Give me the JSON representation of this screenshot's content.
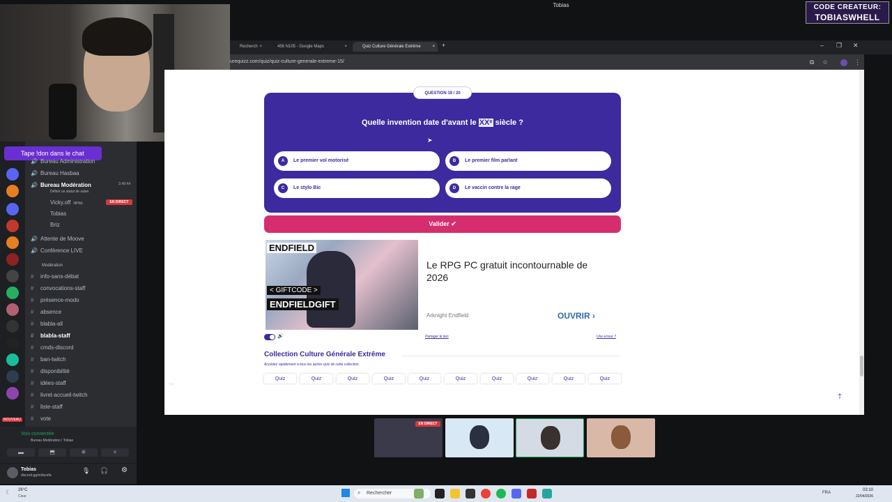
{
  "top_label": "Tobias",
  "creator": {
    "line1": "CODE CREATEUR:",
    "line2": "TOBIASWHELL"
  },
  "chat_prompt": "Tape !don dans le chat",
  "discord": {
    "channels": [
      {
        "label": "Bureau Administration",
        "icon": "🔊"
      },
      {
        "label": "Bureau Hasbaa",
        "icon": "🔊"
      },
      {
        "label": "Bureau Modération",
        "icon": "🔊",
        "active": true,
        "time": "3:49:44"
      },
      {
        "label": "Définir un statut de salon",
        "icon": ""
      },
      {
        "label": "Vicky.off",
        "icon": "",
        "tag": "NFWL"
      },
      {
        "label": "Tobias",
        "icon": ""
      },
      {
        "label": "Briz",
        "icon": ""
      },
      {
        "label": "Attente de Moove",
        "icon": "🔊"
      },
      {
        "label": "Conférence LIVE",
        "icon": "🔊"
      },
      {
        "label": "Modération",
        "icon": ""
      },
      {
        "label": "info-sans-débat",
        "icon": "#"
      },
      {
        "label": "convocations-staff",
        "icon": "#"
      },
      {
        "label": "présence-modo",
        "icon": "#"
      },
      {
        "label": "absence",
        "icon": "#"
      },
      {
        "label": "blabla-all",
        "icon": "#"
      },
      {
        "label": "blabla-staff",
        "icon": "#",
        "active": true
      },
      {
        "label": "cmds-discord",
        "icon": "#"
      },
      {
        "label": "ban-twitch",
        "icon": "#"
      },
      {
        "label": "disponibilité",
        "icon": "#"
      },
      {
        "label": "idées-staff",
        "icon": "#"
      },
      {
        "label": "livret-accueil-twitch",
        "icon": "#"
      },
      {
        "label": "liste-staff",
        "icon": "#"
      },
      {
        "label": "vote",
        "icon": "#"
      }
    ],
    "live_badge": "EN DIRECT",
    "voice_connected": "Voix connectée",
    "voice_channel": "Bureau Modération / Tobias",
    "user_name": "Tobias",
    "user_status": "discord.gg/nofacefa",
    "new_badge": "NOUVEAU"
  },
  "browser": {
    "tabs": [
      {
        "label": "Recherch",
        "close": "×"
      },
      {
        "label": "456 N105 - Google Maps",
        "close": "×"
      },
      {
        "label": "Quiz Culture Générale Extrême",
        "close": "×",
        "active": true
      }
    ],
    "new_tab": "+",
    "url": "urequizz.com/quiz/quiz-culture-generale-extreme-15/",
    "window_controls": [
      "–",
      "❐",
      "✕"
    ]
  },
  "quiz": {
    "badge": "QUESTION 19 / 20",
    "question_before": "Quelle invention date d'avant le ",
    "question_highlight": "XXᵉ",
    "question_after": " siècle ?",
    "answers": [
      {
        "letter": "A",
        "text": "Le premier vol motorisé"
      },
      {
        "letter": "B",
        "text": "Le premier film parlant"
      },
      {
        "letter": "C",
        "text": "Le stylo Bic"
      },
      {
        "letter": "D",
        "text": "Le vaccin contre la rage"
      }
    ],
    "validate_label": "Valider  ✔"
  },
  "ad": {
    "logo": "ENDFIELD",
    "giftcode_label": "< GIFTCODE >",
    "giftcode": "ENDFIELDGIFT",
    "title": "Le RPG PC gratuit incontournable de 2026",
    "source": "Arknight Endfield",
    "cta": "OUVRIR",
    "cta_arrow": "›"
  },
  "share_link": "Partager le lien",
  "error_link": "Une erreur ?",
  "collection": {
    "title": "Collection Culture Générale Extrême",
    "subtitle": "Accédez rapidement à tous les autres quiz de cette collection.",
    "chips": [
      "Quiz",
      "Quiz",
      "Quiz",
      "Quiz",
      "Quiz",
      "Quiz",
      "Quiz",
      "Quiz",
      "Quiz",
      "Quiz"
    ]
  },
  "back_to_top": "🡑",
  "participants_live": "EN DIRECT",
  "taskbar": {
    "temp": "26°C",
    "weather": "Clear",
    "search": "Rechercher",
    "lang": "FRA",
    "time": "03:10",
    "date": "22/04/2026"
  },
  "colors": {
    "accent": "#3d2a9e",
    "cta": "#d62d6e",
    "discord_bg": "#2b2d31"
  }
}
